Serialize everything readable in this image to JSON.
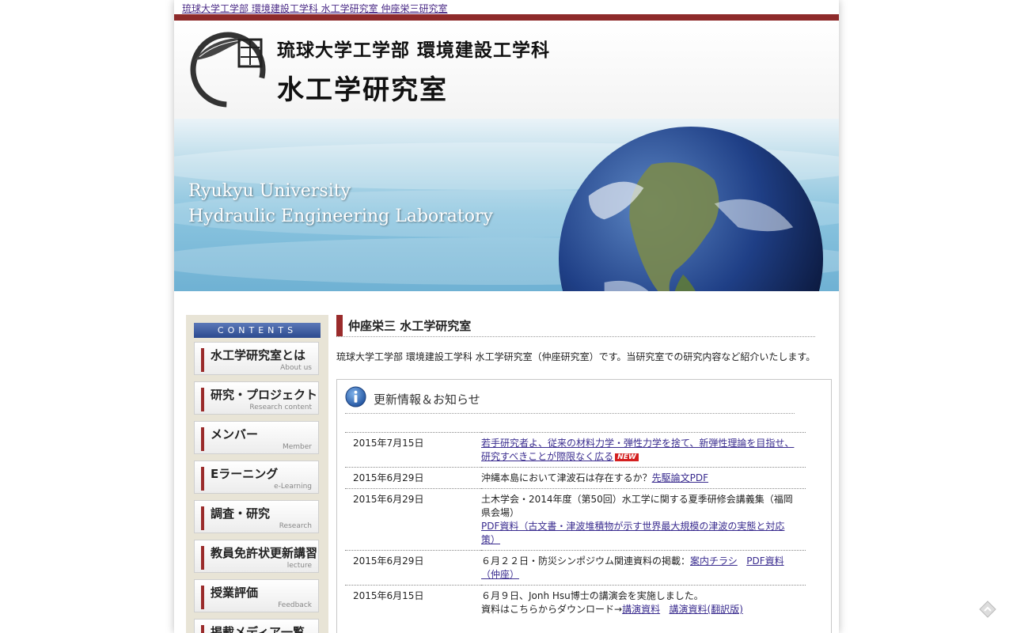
{
  "breadcrumb": {
    "text": "琉球大学工学部 環境建設工学科 水工学研究室 仲座栄三研究室"
  },
  "header": {
    "line1": "琉球大学工学部  環境建設工学科",
    "line2": "水工学研究室",
    "logo_icon": "lab-seal-logo",
    "accent_color": "#8e2b2b"
  },
  "banner": {
    "line1": "Ryukyu University",
    "line2": "Hydraulic Engineering Laboratory"
  },
  "sidebar": {
    "heading": "CONTENTS",
    "items": [
      {
        "jp": "水工学研究室とは",
        "en": "About us"
      },
      {
        "jp": "研究・プロジェクト",
        "en": "Research content"
      },
      {
        "jp": "メンバー",
        "en": "Member"
      },
      {
        "jp": "Eラーニング",
        "en": "e-Learning"
      },
      {
        "jp": "調査・研究",
        "en": "Research"
      },
      {
        "jp": "教員免許状更新講習",
        "en": "lecture"
      },
      {
        "jp": "授業評価",
        "en": "Feedback"
      },
      {
        "jp": "掲載メディア一覧",
        "en": ""
      }
    ]
  },
  "main": {
    "title": "仲座栄三 水工学研究室",
    "intro": "琉球大学工学部 環境建設工学科 水工学研究室（仲座研究室）です。当研究室での研究内容など紹介いたします。",
    "news_heading": "更新情報＆お知らせ",
    "new_badge": "NEW",
    "news": [
      {
        "date": "2015年7月15日",
        "link1": "若手研究者よ、従来の材料力学・弾性力学を捨て、新弾性理論を目指せ、研究すべきことが際限なく広る"
      },
      {
        "date": "2015年6月29日",
        "text": "沖縄本島において津波石は存在するか？",
        "link1": "先駆論文PDF"
      },
      {
        "date": "2015年6月29日",
        "text": "土木学会・2014年度（第50回）水工学に関する夏季研修会講義集（福岡県会場）",
        "link1": "PDF資料（古文書・津波堆積物が示す世界最大規模の津波の実態と対応策）"
      },
      {
        "date": "2015年6月29日",
        "text": "６月２２日・防災シンポジウム関連資料の掲載：",
        "link1": "案内チラシ",
        "link2": "PDF資料（仲座）"
      },
      {
        "date": "2015年6月15日",
        "text": "６月９日、Jonh Hsu博士の講演会を実施しました。",
        "text2": "資料はこちらからダウンロード→",
        "link1": "講演資料",
        "link2": "講演資料(翻訳版)"
      }
    ]
  }
}
